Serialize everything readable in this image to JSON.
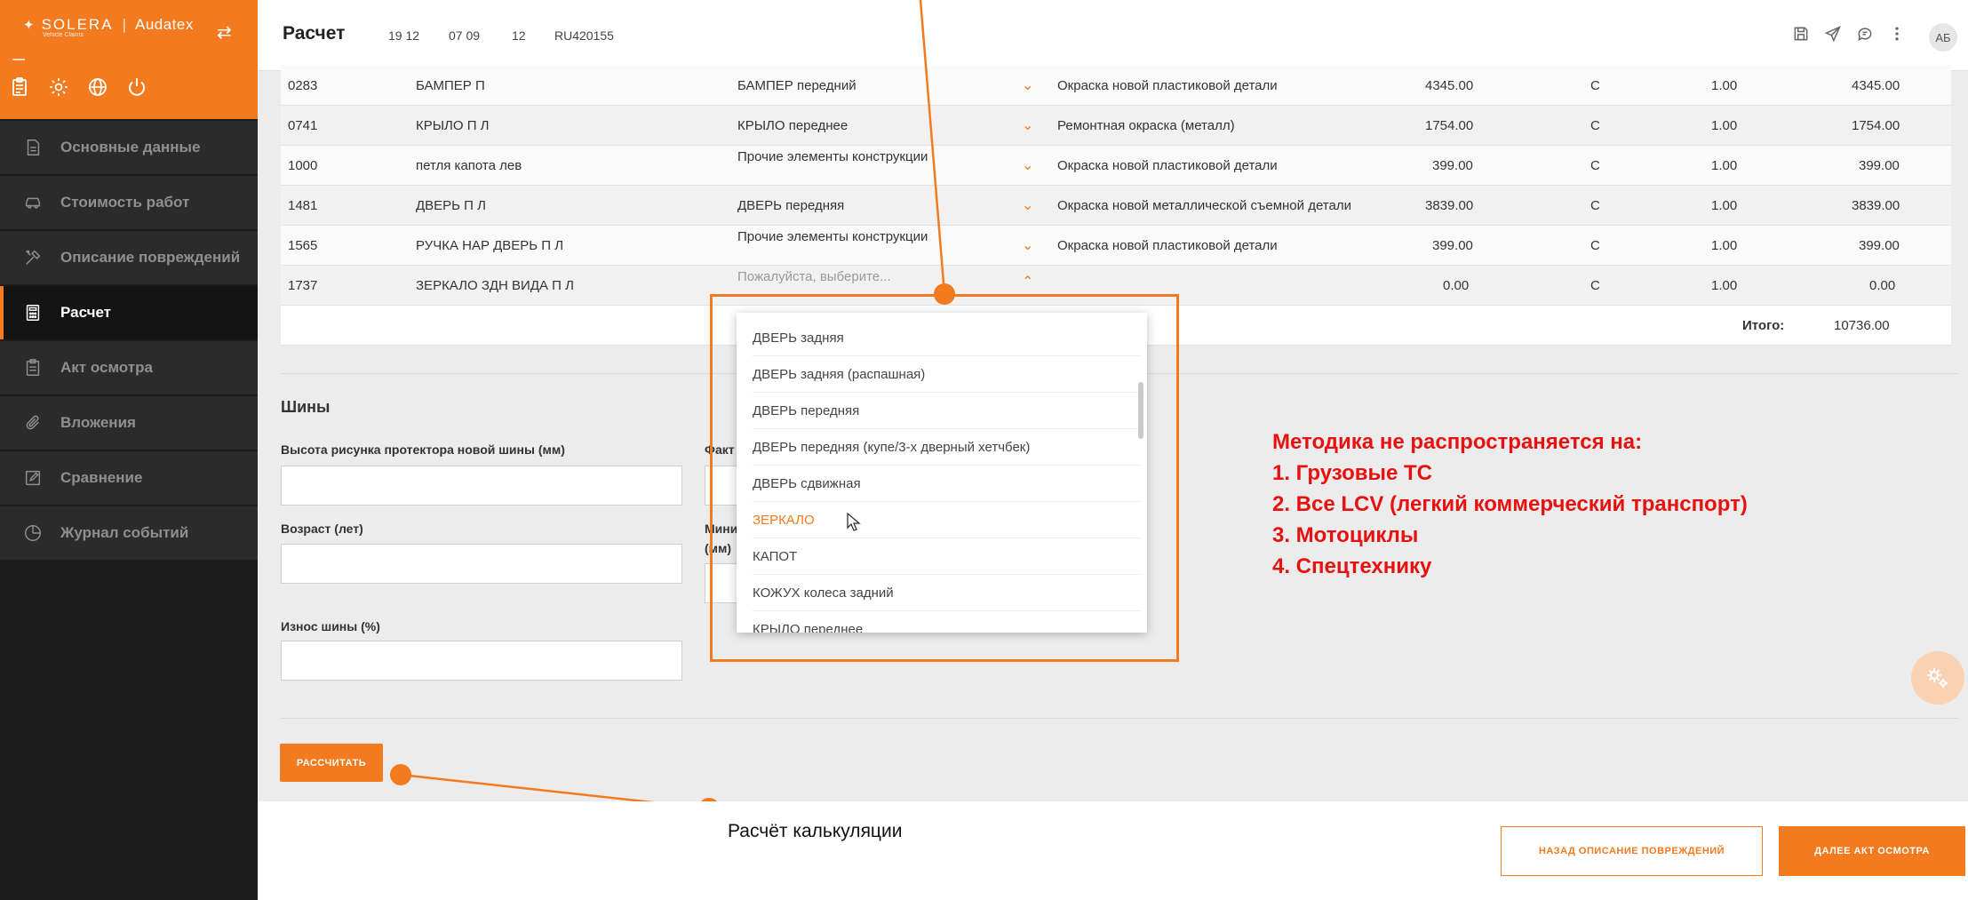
{
  "brand": {
    "name": "SOLERA",
    "product": "Audatex",
    "tagline": "Vehicle Claims"
  },
  "sidebar": {
    "items": [
      {
        "label": "Основные данные",
        "icon": "document-icon"
      },
      {
        "label": "Стоимость работ",
        "icon": "car-icon"
      },
      {
        "label": "Описание повреждений",
        "icon": "tools-icon"
      },
      {
        "label": "Расчет",
        "icon": "calculator-icon"
      },
      {
        "label": "Акт осмотра",
        "icon": "clipboard-icon"
      },
      {
        "label": "Вложения",
        "icon": "paperclip-icon"
      },
      {
        "label": "Сравнение",
        "icon": "edit-icon"
      },
      {
        "label": "Журнал событий",
        "icon": "clock-icon"
      }
    ],
    "active_index": 3
  },
  "header": {
    "title": "Расчет",
    "meta": [
      "19 12",
      "07 09",
      "12",
      "RU420155"
    ],
    "avatar": "АБ"
  },
  "table": {
    "rows": [
      {
        "code": "0283",
        "name": "БАМПЕР П",
        "part": "БАМПЕР передний",
        "work": "Окраска новой пластиковой детали",
        "price": "4345.00",
        "cat": "C",
        "qty": "1.00",
        "sum": "4345.00"
      },
      {
        "code": "0741",
        "name": "КРЫЛО П Л",
        "part": "КРЫЛО переднее",
        "work": "Ремонтная окраска (металл)",
        "price": "1754.00",
        "cat": "C",
        "qty": "1.00",
        "sum": "1754.00"
      },
      {
        "code": "1000",
        "name": "петля капота лев",
        "part": "Прочие элементы конструкции",
        "work": "Окраска новой пластиковой детали",
        "price": "399.00",
        "cat": "C",
        "qty": "1.00",
        "sum": "399.00"
      },
      {
        "code": "1481",
        "name": "ДВЕРЬ П Л",
        "part": "ДВЕРЬ передняя",
        "work": "Окраска новой металлической съемной детали",
        "price": "3839.00",
        "cat": "C",
        "qty": "1.00",
        "sum": "3839.00"
      },
      {
        "code": "1565",
        "name": "РУЧКА НАР ДВЕРЬ П Л",
        "part": "Прочие элементы конструкции",
        "work": "Окраска новой пластиковой детали",
        "price": "399.00",
        "cat": "C",
        "qty": "1.00",
        "sum": "399.00"
      },
      {
        "code": "1737",
        "name": "ЗЕРКАЛО ЗДН ВИДА П Л",
        "part": "Пожалуйста, выберите...",
        "work": "",
        "price": "0.00",
        "cat": "C",
        "qty": "1.00",
        "sum": "0.00"
      }
    ],
    "total_label": "Итого:",
    "total_value": "10736.00"
  },
  "dropdown": {
    "options": [
      "ДВЕРЬ задняя",
      "ДВЕРЬ задняя (распашная)",
      "ДВЕРЬ передняя",
      "ДВЕРЬ передняя (купе/3-х дверный хетчбек)",
      "ДВЕРЬ сдвижная",
      "ЗЕРКАЛО",
      "КАПОТ",
      "КОЖУХ колеса задний",
      "КРЫЛО переднее"
    ],
    "selected_index": 5
  },
  "tires": {
    "title": "Шины",
    "fields": {
      "tread_new": "Высота рисунка протектора новой шины (мм)",
      "actual_prefix": "Факт",
      "age": "Возраст (лет)",
      "min_prefix": "Мини",
      "min_unit": "(мм)",
      "wear": "Износ шины (%)"
    }
  },
  "calc_button": "РАССЧИТАТЬ",
  "annotation": {
    "lines": [
      "Методика не распространяется на:",
      "1. Грузовые ТС",
      "2. Все LCV (легкий коммерческий транспорт)",
      "3. Мотоциклы",
      "4. Спецтехнику"
    ],
    "callout": "Расчёт калькуляции"
  },
  "footer": {
    "back": "НАЗАД ОПИСАНИЕ ПОВРЕЖДЕНИЙ",
    "next": "ДАЛЕЕ АКТ ОСМОТРА"
  },
  "colors": {
    "accent": "#f37a1f",
    "annotation": "#e8110f",
    "sidebar": "#1c1c1c"
  }
}
